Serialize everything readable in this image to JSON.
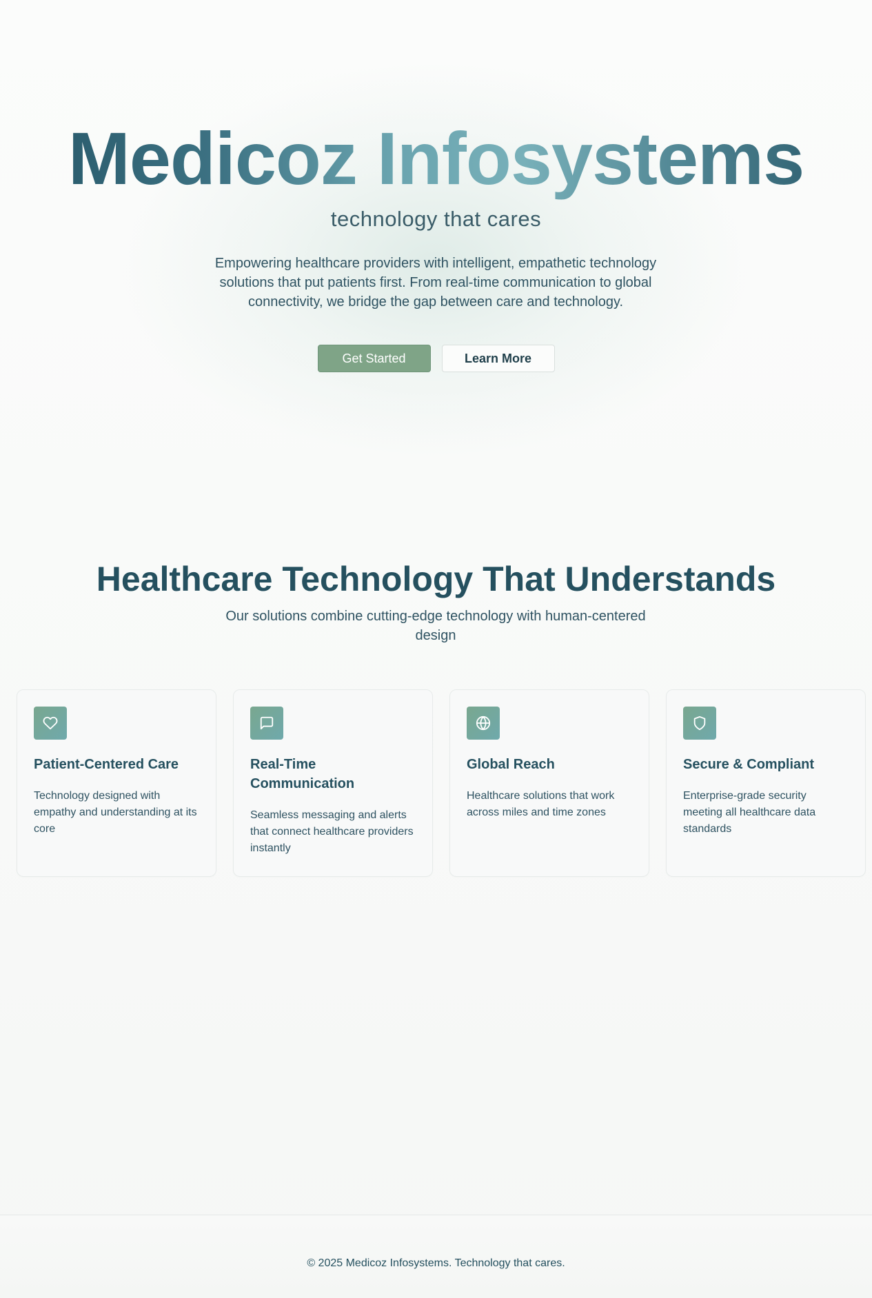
{
  "hero": {
    "title": "Medicoz Infosystems",
    "tagline": "technology that cares",
    "description": "Empowering healthcare providers with intelligent, empathetic technology solutions that put patients first. From real-time communication to global connectivity, we bridge the gap between care and technology.",
    "primary_button": "Get Started",
    "secondary_button": "Learn More"
  },
  "features": {
    "title": "Healthcare Technology That Understands",
    "subtitle": "Our solutions combine cutting-edge technology with human-centered design",
    "cards": [
      {
        "icon": "heart-icon",
        "title": "Patient-Centered Care",
        "description": "Technology designed with empathy and understanding at its core"
      },
      {
        "icon": "message-icon",
        "title": "Real-Time Communication",
        "description": "Seamless messaging and alerts that connect healthcare providers instantly"
      },
      {
        "icon": "globe-icon",
        "title": "Global Reach",
        "description": "Healthcare solutions that work across miles and time zones"
      },
      {
        "icon": "shield-icon",
        "title": "Secure & Compliant",
        "description": "Enterprise-grade security meeting all healthcare data standards"
      }
    ]
  },
  "footer": {
    "text": "© 2025 Medicoz Infosystems. Technology that cares."
  },
  "colors": {
    "primary_text": "#25505f",
    "accent_green": "#7fa487",
    "accent_teal": "#6fa9ac",
    "background": "#f9faf9"
  }
}
